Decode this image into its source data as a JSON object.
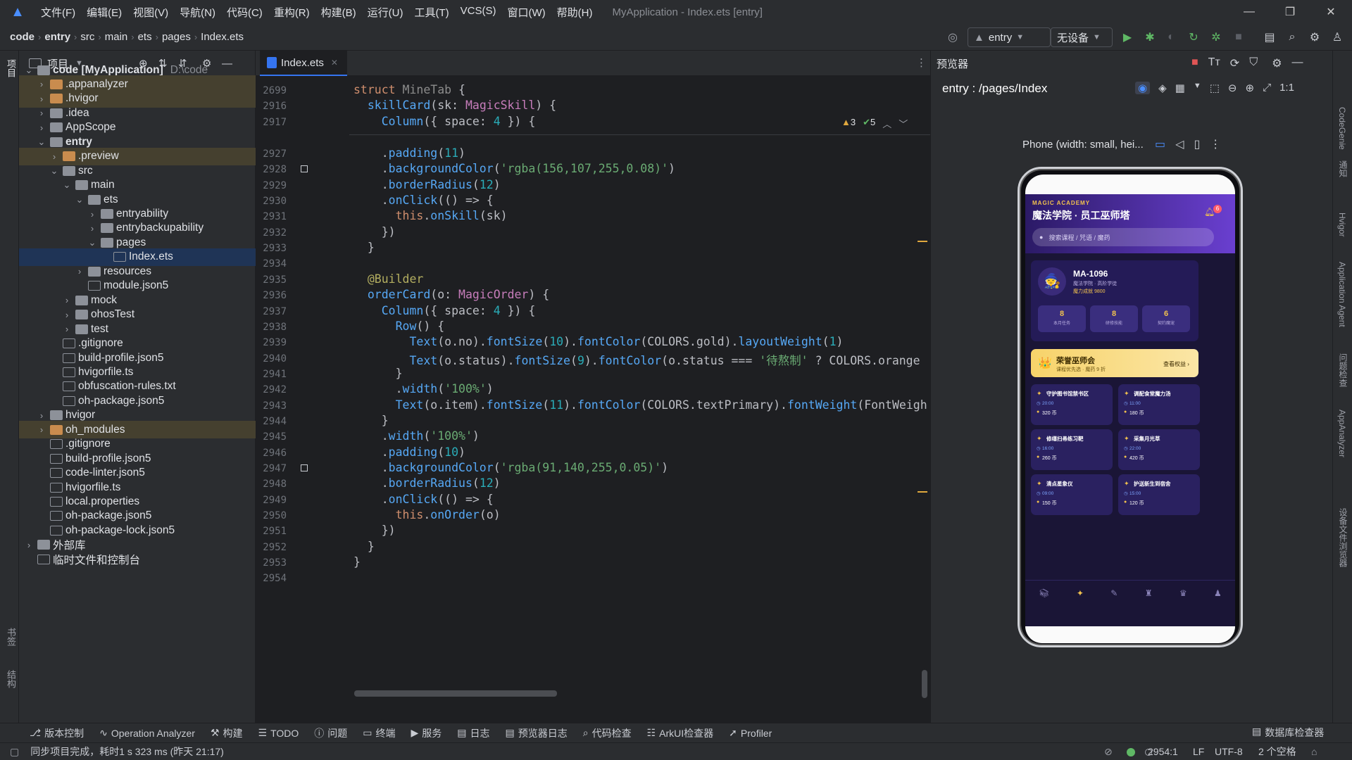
{
  "menu": {
    "items": [
      "文件(F)",
      "编辑(E)",
      "视图(V)",
      "导航(N)",
      "代码(C)",
      "重构(R)",
      "构建(B)",
      "运行(U)",
      "工具(T)",
      "VCS(S)",
      "窗口(W)",
      "帮助(H)"
    ],
    "title": "MyApplication - Index.ets [entry]"
  },
  "breadcrumb": [
    "code",
    "entry",
    "src",
    "main",
    "ets",
    "pages",
    "Index.ets"
  ],
  "toolbar": {
    "module": "entry",
    "device": "无设备"
  },
  "left_strip": {
    "project": "项目",
    "bookmarks": "书签",
    "structure": "结构"
  },
  "project": {
    "header": "项目",
    "tree": [
      {
        "label": "code [MyApplication]",
        "sub": "D:\\code",
        "indent": 0,
        "arrow": "open",
        "icon": "fold",
        "bold": true
      },
      {
        "label": ".appanalyzer",
        "indent": 1,
        "arrow": "closed",
        "icon": "foldo",
        "hl": true
      },
      {
        "label": ".hvigor",
        "indent": 1,
        "arrow": "closed",
        "icon": "foldo",
        "hl": true
      },
      {
        "label": ".idea",
        "indent": 1,
        "arrow": "closed",
        "icon": "fold"
      },
      {
        "label": "AppScope",
        "indent": 1,
        "arrow": "closed",
        "icon": "fold"
      },
      {
        "label": "entry",
        "indent": 1,
        "arrow": "open",
        "icon": "fold",
        "bold": true
      },
      {
        "label": ".preview",
        "indent": 2,
        "arrow": "closed",
        "icon": "foldo",
        "hl": true
      },
      {
        "label": "src",
        "indent": 2,
        "arrow": "open",
        "icon": "fold"
      },
      {
        "label": "main",
        "indent": 3,
        "arrow": "open",
        "icon": "fold"
      },
      {
        "label": "ets",
        "indent": 4,
        "arrow": "open",
        "icon": "fold"
      },
      {
        "label": "entryability",
        "indent": 5,
        "arrow": "closed",
        "icon": "fold"
      },
      {
        "label": "entrybackupability",
        "indent": 5,
        "arrow": "closed",
        "icon": "fold"
      },
      {
        "label": "pages",
        "indent": 5,
        "arrow": "open",
        "icon": "fold"
      },
      {
        "label": "Index.ets",
        "indent": 6,
        "arrow": "",
        "icon": "filei",
        "sel": true
      },
      {
        "label": "resources",
        "indent": 4,
        "arrow": "closed",
        "icon": "fold"
      },
      {
        "label": "module.json5",
        "indent": 4,
        "arrow": "",
        "icon": "filei"
      },
      {
        "label": "mock",
        "indent": 3,
        "arrow": "closed",
        "icon": "fold"
      },
      {
        "label": "ohosTest",
        "indent": 3,
        "arrow": "closed",
        "icon": "fold"
      },
      {
        "label": "test",
        "indent": 3,
        "arrow": "closed",
        "icon": "fold"
      },
      {
        "label": ".gitignore",
        "indent": 2,
        "arrow": "",
        "icon": "filei"
      },
      {
        "label": "build-profile.json5",
        "indent": 2,
        "arrow": "",
        "icon": "filei"
      },
      {
        "label": "hvigorfile.ts",
        "indent": 2,
        "arrow": "",
        "icon": "filei"
      },
      {
        "label": "obfuscation-rules.txt",
        "indent": 2,
        "arrow": "",
        "icon": "filei"
      },
      {
        "label": "oh-package.json5",
        "indent": 2,
        "arrow": "",
        "icon": "filei"
      },
      {
        "label": "hvigor",
        "indent": 1,
        "arrow": "closed",
        "icon": "fold"
      },
      {
        "label": "oh_modules",
        "indent": 1,
        "arrow": "closed",
        "icon": "foldo",
        "hl": true
      },
      {
        "label": ".gitignore",
        "indent": 1,
        "arrow": "",
        "icon": "filei"
      },
      {
        "label": "build-profile.json5",
        "indent": 1,
        "arrow": "",
        "icon": "filei"
      },
      {
        "label": "code-linter.json5",
        "indent": 1,
        "arrow": "",
        "icon": "filei"
      },
      {
        "label": "hvigorfile.ts",
        "indent": 1,
        "arrow": "",
        "icon": "filei"
      },
      {
        "label": "local.properties",
        "indent": 1,
        "arrow": "",
        "icon": "filei"
      },
      {
        "label": "oh-package.json5",
        "indent": 1,
        "arrow": "",
        "icon": "filei"
      },
      {
        "label": "oh-package-lock.json5",
        "indent": 1,
        "arrow": "",
        "icon": "filei"
      },
      {
        "label": "外部库",
        "indent": 0,
        "arrow": "closed",
        "icon": "fold"
      },
      {
        "label": "临时文件和控制台",
        "indent": 0,
        "arrow": "",
        "icon": "filei"
      }
    ]
  },
  "editor": {
    "tab": "Index.ets",
    "inspections": {
      "warnings": "3",
      "ok": "5"
    },
    "sticky": [
      {
        "ln": "2699",
        "html": "<span class=\"kw\">struct</span> <span class=\"gr\">MineTab</span> {"
      },
      {
        "ln": "2916",
        "html": "  <span class=\"fn\">skillCard</span>(sk: <span class=\"ty\">MagicSkill</span>) {"
      },
      {
        "ln": "2917",
        "html": "    <span class=\"fn\">Column</span>({ space: <span class=\"nu\">4</span> }) {"
      }
    ],
    "lines": [
      {
        "ln": "2927",
        "html": "    .<span class=\"fn\">padding</span>(<span class=\"nu\">11</span>)"
      },
      {
        "ln": "2928",
        "html": "    .<span class=\"fn\">backgroundColor</span>(<span class=\"st\">'rgba(156,107,255,0.08)'</span>)",
        "mark": true
      },
      {
        "ln": "2929",
        "html": "    .<span class=\"fn\">borderRadius</span>(<span class=\"nu\">12</span>)"
      },
      {
        "ln": "2930",
        "html": "    .<span class=\"fn\">onClick</span>(() => {"
      },
      {
        "ln": "2931",
        "html": "      <span class=\"kw\">this</span>.<span class=\"fn\">onSkill</span>(sk)"
      },
      {
        "ln": "2932",
        "html": "    })"
      },
      {
        "ln": "2933",
        "html": "  }"
      },
      {
        "ln": "2934",
        "html": ""
      },
      {
        "ln": "2935",
        "html": "  <span class=\"dc\">@Builder</span>"
      },
      {
        "ln": "2936",
        "html": "  <span class=\"fn\">orderCard</span>(o: <span class=\"ty\">MagicOrder</span>) {"
      },
      {
        "ln": "2937",
        "html": "    <span class=\"fn\">Column</span>({ space: <span class=\"nu\">4</span> }) {"
      },
      {
        "ln": "2938",
        "html": "      <span class=\"fn\">Row</span>() {"
      },
      {
        "ln": "2939",
        "html": "        <span class=\"fn\">Text</span>(o.no).<span class=\"fn\">fontSize</span>(<span class=\"nu\">10</span>).<span class=\"fn\">fontColor</span>(COLORS.gold).<span class=\"fn\">layoutWeight</span>(<span class=\"nu\">1</span>)"
      },
      {
        "ln": "2940",
        "html": "        <span class=\"fn\">Text</span>(o.status).<span class=\"fn\">fontSize</span>(<span class=\"nu\">9</span>).<span class=\"fn\">fontColor</span>(o.status === <span class=\"st\">'待熬制'</span> ? COLORS.orange"
      },
      {
        "ln": "2941",
        "html": "      }"
      },
      {
        "ln": "2942",
        "html": "      .<span class=\"fn\">width</span>(<span class=\"st\">'100%'</span>)"
      },
      {
        "ln": "2943",
        "html": "      <span class=\"fn\">Text</span>(o.item).<span class=\"fn\">fontSize</span>(<span class=\"nu\">11</span>).<span class=\"fn\">fontColor</span>(COLORS.textPrimary).<span class=\"fn\">fontWeight</span>(FontWeigh"
      },
      {
        "ln": "2944",
        "html": "    }"
      },
      {
        "ln": "2945",
        "html": "    .<span class=\"fn\">width</span>(<span class=\"st\">'100%'</span>)"
      },
      {
        "ln": "2946",
        "html": "    .<span class=\"fn\">padding</span>(<span class=\"nu\">10</span>)"
      },
      {
        "ln": "2947",
        "html": "    .<span class=\"fn\">backgroundColor</span>(<span class=\"st\">'rgba(91,140,255,0.05)'</span>)",
        "mark": true
      },
      {
        "ln": "2948",
        "html": "    .<span class=\"fn\">borderRadius</span>(<span class=\"nu\">12</span>)"
      },
      {
        "ln": "2949",
        "html": "    .<span class=\"fn\">onClick</span>(() => {"
      },
      {
        "ln": "2950",
        "html": "      <span class=\"kw\">this</span>.<span class=\"fn\">onOrder</span>(o)"
      },
      {
        "ln": "2951",
        "html": "    })"
      },
      {
        "ln": "2952",
        "html": "  }"
      },
      {
        "ln": "2953",
        "html": "}"
      },
      {
        "ln": "2954",
        "html": ""
      }
    ]
  },
  "preview": {
    "panel_title": "预览器",
    "route": "entry : /pages/Index",
    "device_label": "Phone (width: small, hei...",
    "app": {
      "brand": "MAGIC ACADEMY",
      "title": "魔法学院 · 员工巫师塔",
      "badge": "6",
      "search_placeholder": "搜索课程 / 咒语 / 魔药",
      "profile": {
        "id": "MA-1096",
        "line1": "魔法学院 · 高阶学徒",
        "line2": "魔力成就 9800"
      },
      "stats": [
        {
          "v": "8",
          "l": "本月任务"
        },
        {
          "v": "8",
          "l": "研修技能"
        },
        {
          "v": "6",
          "l": "契约魔宠"
        }
      ],
      "honor": {
        "title": "荣誉巫师会",
        "sub": "课程优先选 · 魔药 9 折",
        "action": "查看权益 ›"
      },
      "cards": [
        {
          "name": "守护图书馆禁书区",
          "time": "20:00",
          "coin": "320 币"
        },
        {
          "name": "调配食堂魔力汤",
          "time": "11:00",
          "coin": "180 币"
        },
        {
          "name": "修缮扫帚练习靶",
          "time": "16:00",
          "coin": "260 币"
        },
        {
          "name": "采集月光草",
          "time": "22:00",
          "coin": "420 币"
        },
        {
          "name": "清点星象仪",
          "time": "09:00",
          "coin": "150 币"
        },
        {
          "name": "护送新生到宿舍",
          "time": "15:00",
          "coin": "120 币"
        }
      ]
    }
  },
  "right_strip": [
    "CodeGenie",
    "通知",
    "Hvigor",
    "Application Agent",
    "问题检查",
    "AppAnalyzer",
    "设备文件浏览器"
  ],
  "bottom_tools": [
    "版本控制",
    "Operation Analyzer",
    "构建",
    "TODO",
    "问题",
    "终端",
    "服务",
    "日志",
    "预览器日志",
    "代码检查",
    "ArkUI检查器",
    "Profiler"
  ],
  "bottom_right": "数据库检查器",
  "status": {
    "message": "同步项目完成，耗时1 s 323 ms (昨天 21:17)",
    "position": "2954:1",
    "line_sep": "LF",
    "encoding": "UTF-8",
    "indent": "2 个空格"
  }
}
